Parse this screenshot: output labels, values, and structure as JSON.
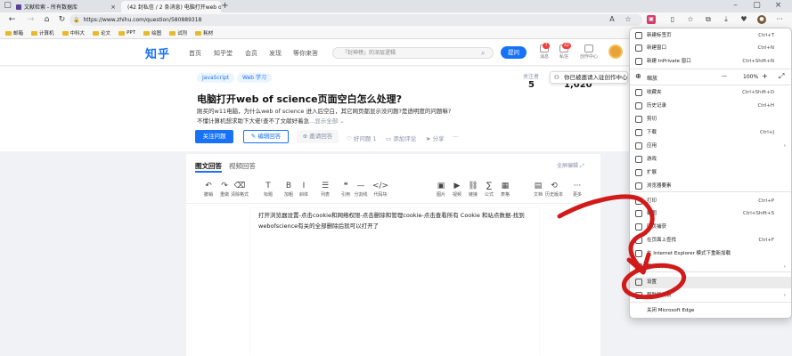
{
  "browser": {
    "tabs": [
      {
        "title": "文献检索 - 所有数据库"
      },
      {
        "title": "(42 封私信 / 2 条消息) 电脑打开web of..."
      }
    ],
    "url": "https://www.zhihu.com/question/580889318",
    "bookmarks": [
      "邮箱",
      "计算机",
      "中科大",
      "论文",
      "PPT",
      "绘图",
      "试剂",
      "耗材"
    ]
  },
  "zhihu": {
    "logo": "知乎",
    "nav": [
      "首页",
      "知乎堂",
      "会员",
      "发现",
      "等你来答"
    ],
    "search_placeholder": "「封神榜」的深层逻辑",
    "ask_label": "提问",
    "header_icons": [
      {
        "label": "消息",
        "badge": "7"
      },
      {
        "label": "私信",
        "badge": "42"
      },
      {
        "label": "创作中心",
        "badge": ""
      }
    ]
  },
  "question": {
    "tags": [
      "JavaScript",
      "Web 学习"
    ],
    "title": "电脑打开web of science页面空白怎么处理?",
    "desc_line1": "刚买的w11电脑，为什么web of science 进入后空白，其它网页都显示没问题?是透明度的问题嘛?",
    "desc_line2": "不懂计算机想求助下大佬!查不了文献好着急",
    "show_all": "...显示全部 ",
    "follow_btn": "关注问题",
    "write_btn": "编辑回答",
    "invite_btn": "邀请回答",
    "good_q": "好问题 1",
    "comment": "添加评论",
    "share": "分享",
    "more": "···",
    "followers_label": "关注者",
    "followers": "5",
    "views": "1,020",
    "notification": "你已被邀请入驻创作中心"
  },
  "editor": {
    "tabs": [
      "图文回答",
      "视频回答"
    ],
    "fullscreen": "全屏编辑",
    "tools": [
      "撤销",
      "重做",
      "清除格式",
      "标题",
      "加粗",
      "斜体",
      "列表",
      "引用",
      "分割线",
      "代码块",
      "图片",
      "视频",
      "链接",
      "公式",
      "表格",
      "文档",
      "历史版本",
      "更多"
    ],
    "tool_glyphs": [
      "↶",
      "↷",
      "⌫",
      "T",
      "B",
      "I",
      "☰",
      "❝",
      "—",
      "</>",
      "▣",
      "▶",
      "⛓",
      "∑",
      "▦",
      "▤",
      "⟲",
      "···"
    ],
    "answer": "打开浏览器设置-点击cookie和网络权限-点击删除和管理cookie-点击查看所有 Cookie 和站点数据-找到webofscience有关的全部删除后就可以打开了"
  },
  "menu": {
    "items": [
      {
        "label": "新建标签页",
        "shortcut": "Ctrl+T"
      },
      {
        "label": "新建窗口",
        "shortcut": "Ctrl+N"
      },
      {
        "label": "新建 InPrivate 窗口",
        "shortcut": "Ctrl+Shift+N"
      },
      {
        "label": "收藏夹",
        "shortcut": "Ctrl+Shift+O"
      },
      {
        "label": "历史记录",
        "shortcut": "Ctrl+H"
      },
      {
        "label": "剪切",
        "shortcut": ""
      },
      {
        "label": "下载",
        "shortcut": "Ctrl+J"
      },
      {
        "label": "应用",
        "shortcut": ""
      },
      {
        "label": "游戏",
        "shortcut": ""
      },
      {
        "label": "扩展",
        "shortcut": ""
      },
      {
        "label": "浏览器要素",
        "shortcut": ""
      },
      {
        "label": "打印",
        "shortcut": "Ctrl+P"
      },
      {
        "label": "截图",
        "shortcut": "Ctrl+Shift+S"
      },
      {
        "label": "网页捕获",
        "shortcut": ""
      },
      {
        "label": "在页面上查找",
        "shortcut": "Ctrl+F"
      },
      {
        "label": "在 Internet Explorer 模式下重新加载",
        "shortcut": ""
      },
      {
        "label": "更多工具",
        "shortcut": ""
      },
      {
        "label": "设置",
        "shortcut": ""
      },
      {
        "label": "帮助和反馈",
        "shortcut": ""
      },
      {
        "label": "关闭 Microsoft Edge",
        "shortcut": ""
      }
    ],
    "zoom_label": "缩放",
    "zoom_minus": "—",
    "zoom_value": "100%",
    "zoom_plus": "+",
    "arrow": "›"
  },
  "colors": {
    "zhihu_blue": "#1772f6",
    "annotation_red": "#d11a1a",
    "menu_highlight": "#ebebeb"
  }
}
